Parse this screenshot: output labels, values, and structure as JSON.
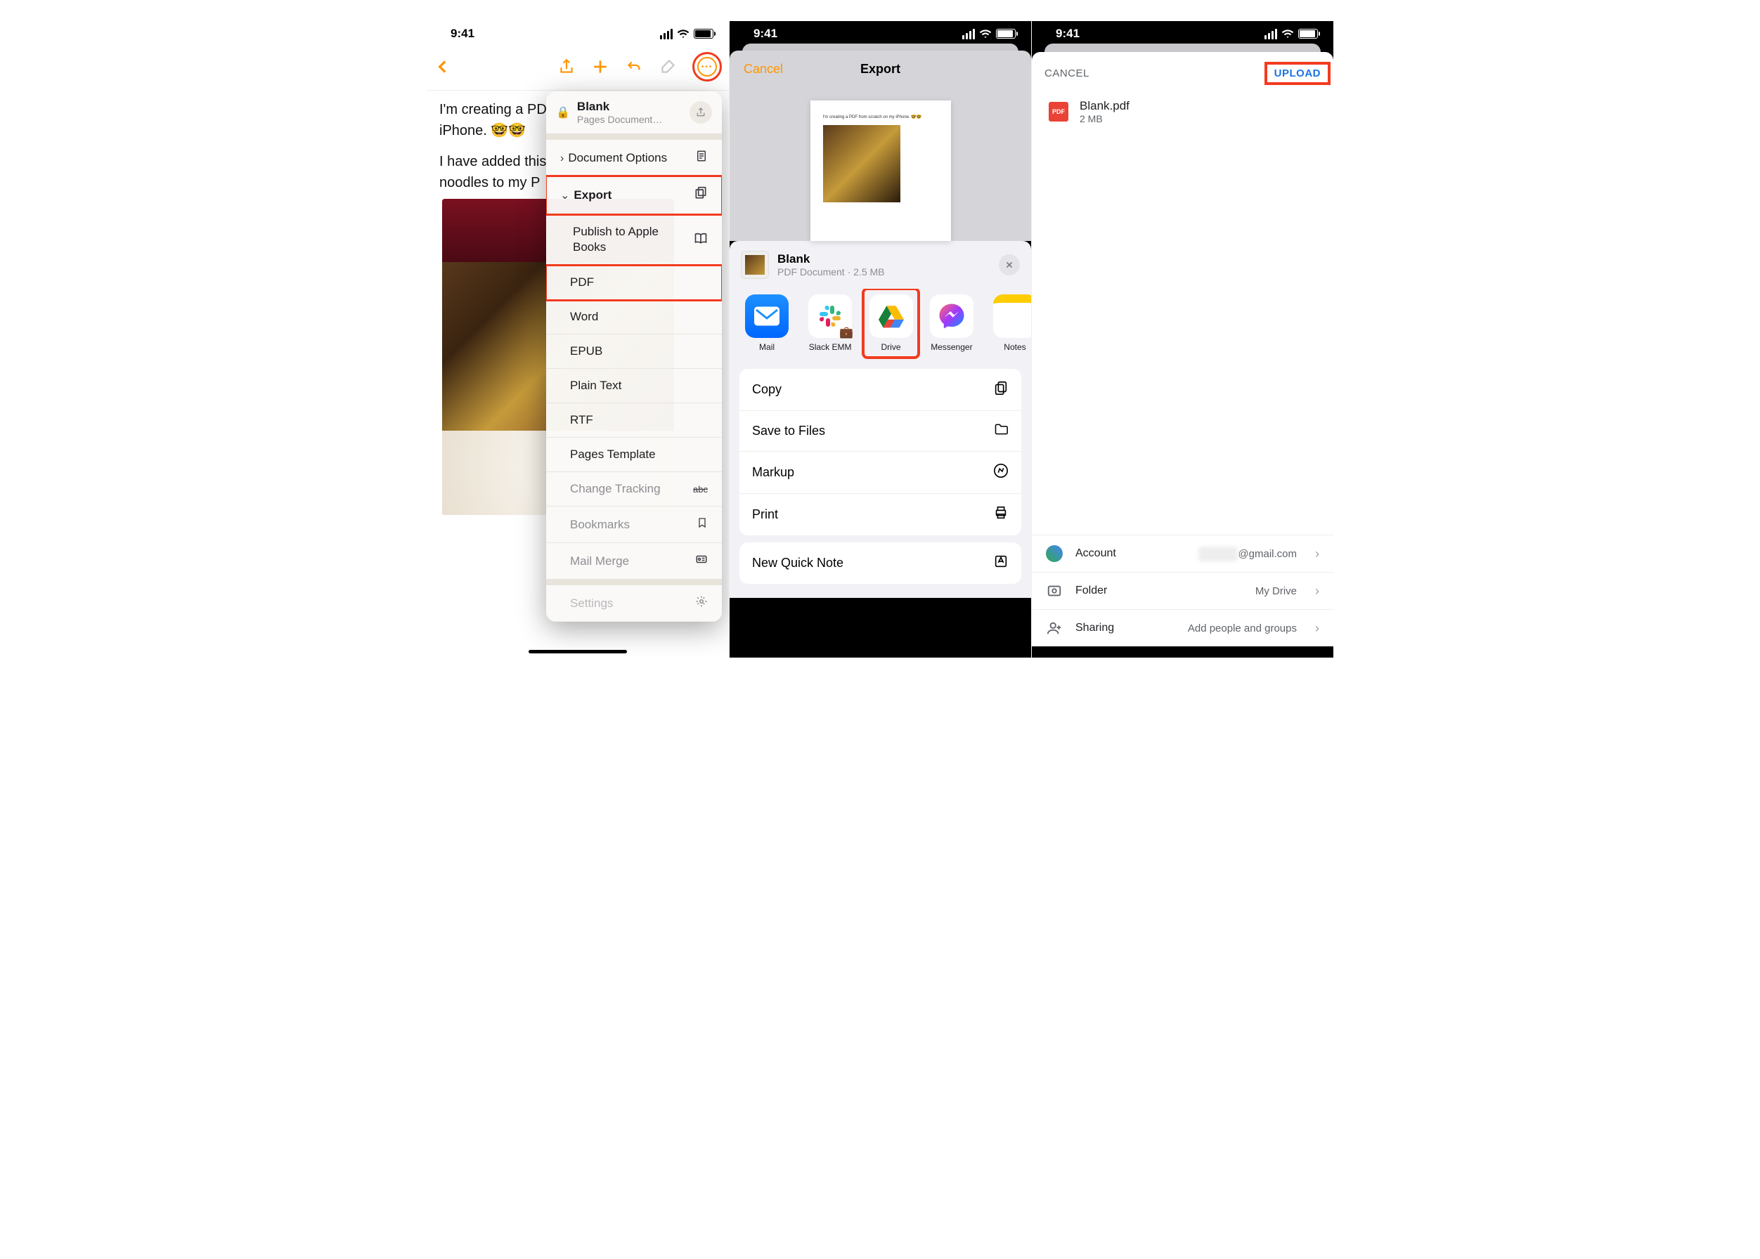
{
  "status": {
    "time": "9:41"
  },
  "screen1": {
    "body_line1": "I'm creating a PD",
    "body_line2": "iPhone. 🤓🤓",
    "body_line3": "I have added this",
    "body_line4": "noodles to my P",
    "doc_title": "Blank",
    "doc_sub": "Pages Document…",
    "menu": {
      "doc_options": "Document Options",
      "export": "Export",
      "publish": "Publish to Apple Books",
      "pdf": "PDF",
      "word": "Word",
      "epub": "EPUB",
      "plain": "Plain Text",
      "rtf": "RTF",
      "template": "Pages Template",
      "tracking": "Change Tracking",
      "bookmarks": "Bookmarks",
      "mailmerge": "Mail Merge",
      "settings": "Settings"
    }
  },
  "screen2": {
    "cancel": "Cancel",
    "title": "Export",
    "preview_text": "I'm creating a PDF from scratch on my iPhone. 🤓🤓",
    "share_title": "Blank",
    "share_sub": "PDF Document · 2.5 MB",
    "apps": {
      "mail": "Mail",
      "slack": "Slack EMM",
      "drive": "Drive",
      "messenger": "Messenger",
      "notes": "Notes"
    },
    "actions": {
      "copy": "Copy",
      "save": "Save to Files",
      "markup": "Markup",
      "print": "Print",
      "quick": "New Quick Note"
    }
  },
  "screen3": {
    "cancel": "CANCEL",
    "upload": "UPLOAD",
    "filename": "Blank.pdf",
    "filesize": "2 MB",
    "account_label": "Account",
    "account_val": "@gmail.com",
    "folder_label": "Folder",
    "folder_val": "My Drive",
    "sharing_label": "Sharing",
    "sharing_val": "Add people and groups"
  }
}
